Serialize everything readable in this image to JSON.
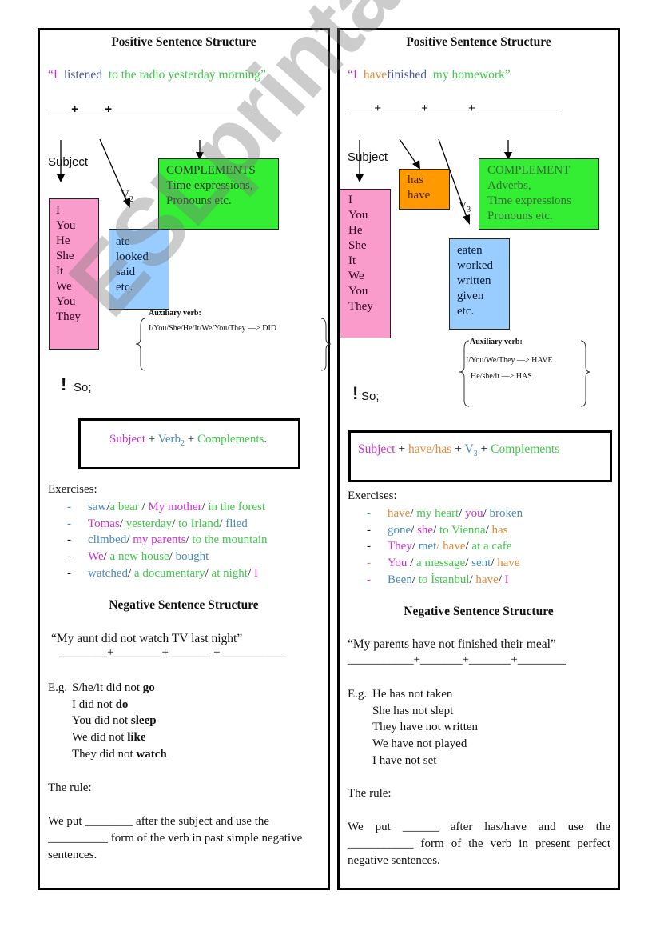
{
  "left": {
    "title": "Positive Sentence Structure",
    "example": {
      "open_quote": "“",
      "subject": "I",
      "verb": "listened",
      "complement": "to the radio yesterday morning",
      "close_quote": "”"
    },
    "blanks": "___ +____+_____________________",
    "subject_label": "Subject",
    "verb_label": "V",
    "verb_sub": "2",
    "subjects": [
      "I",
      "You",
      "He",
      "She",
      "It",
      "We",
      "You",
      "They"
    ],
    "verbs": [
      "ate",
      "looked",
      "said",
      "etc."
    ],
    "complements": [
      "COMPLEMENTS",
      "Time expressions,",
      "Pronouns etc."
    ],
    "aux_title": "Auxiliary verb:",
    "aux_lines": [
      "I/You/She/He/It/We/You/They —> DID"
    ],
    "so_mark": "!",
    "so_label": "So;",
    "formula": {
      "subject": "Subject",
      "plus1": " + ",
      "verb": "Verb",
      "verb_sub": "2",
      "plus2": " + ",
      "complements": "Complements",
      "period": "."
    },
    "exercises_title": "Exercises:",
    "exercises": [
      [
        {
          "t": "saw",
          "c": "blue"
        },
        {
          "t": "/",
          "c": "black"
        },
        {
          "t": "a bear ",
          "c": "green"
        },
        {
          "t": "/ ",
          "c": "black"
        },
        {
          "t": "My mother",
          "c": "pink"
        },
        {
          "t": "/ ",
          "c": "black"
        },
        {
          "t": "in the forest",
          "c": "green"
        }
      ],
      [
        {
          "t": "Tomas",
          "c": "pink"
        },
        {
          "t": "/ ",
          "c": "black"
        },
        {
          "t": "yesterday",
          "c": "green"
        },
        {
          "t": "/ ",
          "c": "black"
        },
        {
          "t": "to Irland",
          "c": "green"
        },
        {
          "t": "/ ",
          "c": "black"
        },
        {
          "t": "flied",
          "c": "blue"
        }
      ],
      [
        {
          "t": "climbed",
          "c": "blue"
        },
        {
          "t": "/ ",
          "c": "black"
        },
        {
          "t": "my parents",
          "c": "pink"
        },
        {
          "t": "/ ",
          "c": "black"
        },
        {
          "t": "to the mountain",
          "c": "green"
        }
      ],
      [
        {
          "t": "We",
          "c": "pink"
        },
        {
          "t": "/ ",
          "c": "black"
        },
        {
          "t": "a new house",
          "c": "green"
        },
        {
          "t": "/ ",
          "c": "black"
        },
        {
          "t": "bought",
          "c": "blue"
        }
      ],
      [
        {
          "t": "watched",
          "c": "blue"
        },
        {
          "t": "/ ",
          "c": "black"
        },
        {
          "t": "a documentary",
          "c": "green"
        },
        {
          "t": "/ ",
          "c": "black"
        },
        {
          "t": "at night",
          "c": "green"
        },
        {
          "t": "/ ",
          "c": "black"
        },
        {
          "t": "I",
          "c": "pink"
        }
      ]
    ],
    "exercise_dash_colors": [
      "blue",
      "blue",
      "black",
      "black",
      "black"
    ],
    "neg_title": "Negative Sentence Structure",
    "neg_example": "“My aunt  did   not   watch   TV last night”",
    "neg_blanks": "________+________+_______ +___________",
    "eg_label": "E.g.",
    "eg_lines": [
      {
        "pre": "S/he/it did not ",
        "bold": "go"
      },
      {
        "pre": "I did not ",
        "bold": "do"
      },
      {
        "pre": "You did not ",
        "bold": "sleep"
      },
      {
        "pre": "We did not ",
        "bold": "like"
      },
      {
        "pre": "They did not ",
        "bold": "watch"
      }
    ],
    "rule_title": "The rule:",
    "rule_text": "We put ________ after the subject and use the __________ form of the verb in past simple negative sentences."
  },
  "right": {
    "title": "Positive Sentence Structure",
    "example": {
      "open_quote": "“",
      "subject": "I",
      "aux": "have",
      "verb": "finished",
      "complement": "my homework",
      "close_quote": "”"
    },
    "blanks": "____+______+______+_____________",
    "subject_label": "Subject",
    "verb_label": "V",
    "verb_sub": "3",
    "subjects": [
      "I",
      "You",
      "He",
      "She",
      "It",
      "We",
      "You",
      "They"
    ],
    "aux_words": [
      "has",
      "have"
    ],
    "verbs": [
      "eaten",
      "worked",
      "written",
      "given",
      "etc."
    ],
    "complements": [
      "COMPLEMENT",
      "Adverbs,",
      "Time expressions",
      "Pronouns etc."
    ],
    "aux_title": "Auxiliary verb:",
    "aux_lines": [
      "I/You/We/They —> HAVE",
      "He/she/it —> HAS"
    ],
    "so_mark": "!",
    "so_label": "So;",
    "formula": {
      "subject": "Subject",
      "plus1": " + ",
      "aux": "have/has",
      "plus2": " + ",
      "verb": "V",
      "verb_sub": "3",
      "plus3": " + ",
      "complements": "Complements"
    },
    "exercises_title": "Exercises:",
    "exercises": [
      [
        {
          "t": "have",
          "c": "orange"
        },
        {
          "t": "/ ",
          "c": "black"
        },
        {
          "t": "my heart",
          "c": "green"
        },
        {
          "t": "/ ",
          "c": "black"
        },
        {
          "t": "you",
          "c": "pink"
        },
        {
          "t": "/ ",
          "c": "black"
        },
        {
          "t": "broken",
          "c": "blue"
        }
      ],
      [
        {
          "t": "gone",
          "c": "blue"
        },
        {
          "t": "/ ",
          "c": "black"
        },
        {
          "t": "she",
          "c": "pink"
        },
        {
          "t": "/ ",
          "c": "black"
        },
        {
          "t": "to Vienna",
          "c": "green"
        },
        {
          "t": "/ ",
          "c": "black"
        },
        {
          "t": "has",
          "c": "orange"
        }
      ],
      [
        {
          "t": "They",
          "c": "pink"
        },
        {
          "t": "/ ",
          "c": "black"
        },
        {
          "t": "met",
          "c": "blue"
        },
        {
          "t": "/ ",
          "c": "orange"
        },
        {
          "t": "have",
          "c": "orange"
        },
        {
          "t": "/ ",
          "c": "black"
        },
        {
          "t": "at a cafe",
          "c": "green"
        }
      ],
      [
        {
          "t": "You ",
          "c": "pink"
        },
        {
          "t": "/ ",
          "c": "black"
        },
        {
          "t": "a message",
          "c": "green"
        },
        {
          "t": "/ ",
          "c": "black"
        },
        {
          "t": "sent",
          "c": "blue"
        },
        {
          "t": "/ ",
          "c": "black"
        },
        {
          "t": "have",
          "c": "orange"
        }
      ],
      [
        {
          "t": "Been",
          "c": "blue"
        },
        {
          "t": "/ ",
          "c": "black"
        },
        {
          "t": "to İstanbul",
          "c": "green"
        },
        {
          "t": "/ ",
          "c": "black"
        },
        {
          "t": "have",
          "c": "orange"
        },
        {
          "t": "/ ",
          "c": "black"
        },
        {
          "t": "I",
          "c": "pink"
        }
      ]
    ],
    "exercise_dash_colors": [
      "blue",
      "black",
      "black",
      "orange",
      "pink"
    ],
    "neg_title": "Negative Sentence Structure",
    "neg_example": "“My parents  have not finished their meal”",
    "neg_blanks": "___________+_______+_______+________",
    "eg_label": "E.g.",
    "eg_lines": [
      {
        "pre": "He has not taken",
        "bold": ""
      },
      {
        "pre": "She has not slept",
        "bold": ""
      },
      {
        "pre": "They have not written",
        "bold": ""
      },
      {
        "pre": "We have not played",
        "bold": ""
      },
      {
        "pre": "I have not set",
        "bold": ""
      }
    ],
    "rule_title": "The rule:",
    "rule_text": "We put ______ after has/have and use the ___________ form of the verb in present perfect negative sentences."
  },
  "watermark": "ESLprintables.com",
  "colors": {
    "pink": "#cc33cc",
    "blue": "#4a8ab8",
    "green": "#3fc84a",
    "orange": "#e08a3a",
    "black": "#111111",
    "box_pink": "#f99ccc",
    "box_blue": "#99ccff",
    "box_green": "#33ee33",
    "box_orange": "#ff9900"
  }
}
